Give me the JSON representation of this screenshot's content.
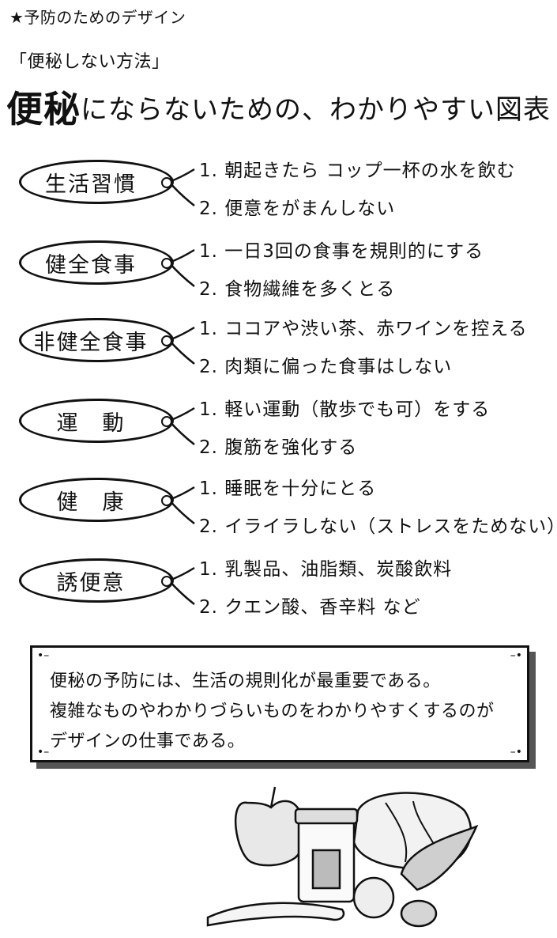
{
  "header": {
    "category": "★予防のためのデザイン",
    "subtitle": "「便秘しない方法」"
  },
  "title": {
    "bold_part": "便秘",
    "rest": "にならないための、わかりやすい図表"
  },
  "sections": [
    {
      "label": "生活習慣",
      "items": [
        "1. 朝起きたら コップ一杯の水を飲む",
        "2. 便意をがまんしない"
      ]
    },
    {
      "label": "健全食事",
      "items": [
        "1. 一日3回の食事を規則的にする",
        "2. 食物繊維を多くとる"
      ]
    },
    {
      "label": "非健全食事",
      "items": [
        "1. ココアや渋い茶、赤ワインを控える",
        "2. 肉類に偏った食事はしない"
      ]
    },
    {
      "label": "運　動",
      "items": [
        "1. 軽い運動（散歩でも可）をする",
        "2. 腹筋を強化する"
      ]
    },
    {
      "label": "健　康",
      "items": [
        "1. 睡眠を十分にとる",
        "2. イライラしない（ストレスをためない）"
      ]
    },
    {
      "label": "誘便意",
      "items": [
        "1. 乳製品、油脂類、炭酸飲料",
        "2. クエン酸、香辛料 など"
      ]
    }
  ],
  "note": {
    "lines": [
      "便秘の予防には、生活の規則化が最重要である。",
      "複雑なものやわかりづらいものをわかりやすくするのが",
      "デザインの仕事である。"
    ]
  },
  "illustration": {
    "icon": "fruit-and-vegetables-illustration"
  }
}
